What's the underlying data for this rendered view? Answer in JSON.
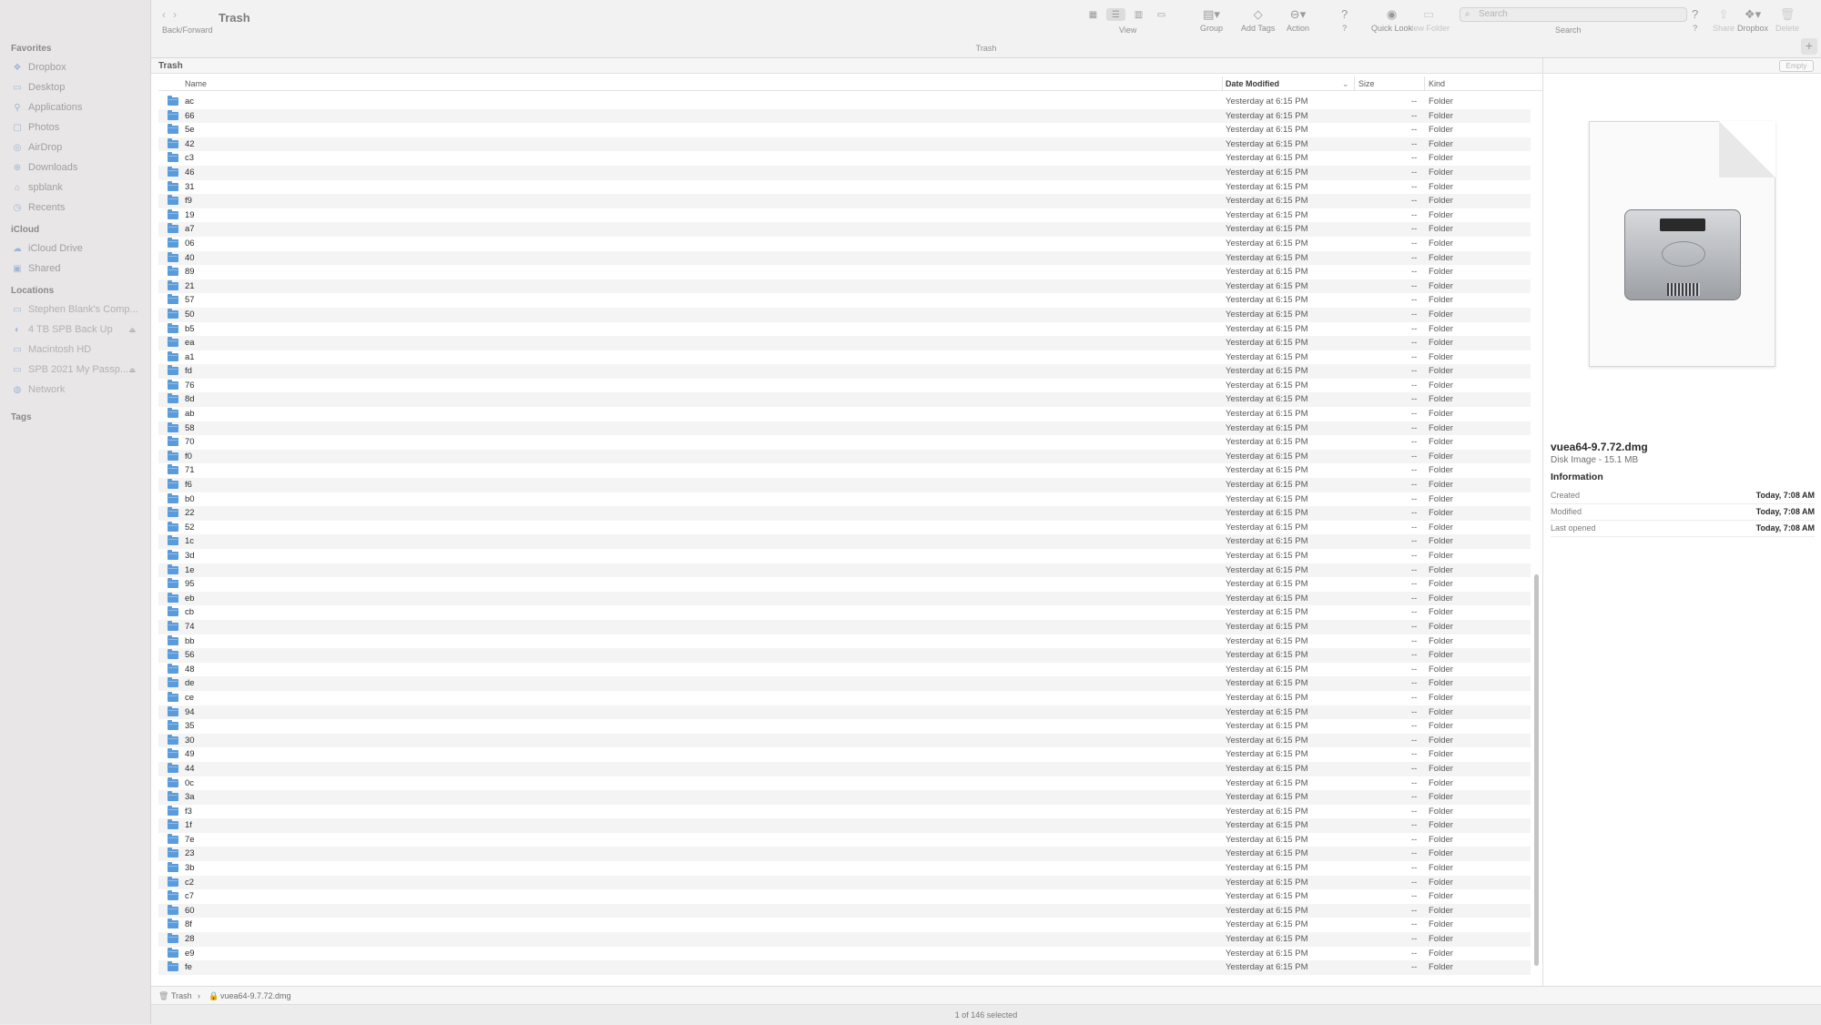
{
  "toolbar": {
    "nav_label": "Back/Forward",
    "title": "Trash",
    "view_label": "View",
    "group_label": "Group",
    "add_tags_label": "Add Tags",
    "action_label": "Action",
    "help_label": "?",
    "quick_look_label": "Quick Look",
    "new_folder_label": "New Folder",
    "search_placeholder": "Search",
    "search_label": "Search",
    "help2_label": "?",
    "share_label": "Share",
    "dropbox_label": "Dropbox",
    "delete_label": "Delete",
    "path_title": "Trash"
  },
  "sidebar": {
    "favorites_title": "Favorites",
    "favorites": [
      {
        "label": "Dropbox",
        "icon": "dropbox-icon"
      },
      {
        "label": "Desktop",
        "icon": "desktop-icon"
      },
      {
        "label": "Applications",
        "icon": "applications-icon"
      },
      {
        "label": "Photos",
        "icon": "photos-icon"
      },
      {
        "label": "AirDrop",
        "icon": "airdrop-icon"
      },
      {
        "label": "Downloads",
        "icon": "downloads-icon"
      },
      {
        "label": "spblank",
        "icon": "home-icon"
      },
      {
        "label": "Recents",
        "icon": "recents-icon"
      }
    ],
    "icloud_title": "iCloud",
    "icloud": [
      {
        "label": "iCloud Drive",
        "icon": "icloud-icon"
      },
      {
        "label": "Shared",
        "icon": "shared-folder-icon"
      }
    ],
    "locations_title": "Locations",
    "locations": [
      {
        "label": "Stephen Blank's Comp...",
        "icon": "computer-icon"
      },
      {
        "label": "4 TB SPB Back Up",
        "icon": "timemachine-icon",
        "eject": true
      },
      {
        "label": "Macintosh HD",
        "icon": "disk-icon"
      },
      {
        "label": "SPB 2021 My Passp...",
        "icon": "disk-icon",
        "eject": true
      },
      {
        "label": "Network",
        "icon": "network-icon"
      }
    ],
    "tags_title": "Tags"
  },
  "content": {
    "header": "Trash",
    "empty_button": "Empty",
    "columns": {
      "name": "Name",
      "date": "Date Modified",
      "size": "Size",
      "kind": "Kind"
    },
    "date_value": "Yesterday at 6:15 PM",
    "size_value": "--",
    "kind_value": "Folder",
    "rows": [
      "ac",
      "66",
      "5e",
      "42",
      "c3",
      "46",
      "31",
      "f9",
      "19",
      "a7",
      "06",
      "40",
      "89",
      "21",
      "57",
      "50",
      "b5",
      "ea",
      "a1",
      "fd",
      "76",
      "8d",
      "ab",
      "58",
      "70",
      "f0",
      "71",
      "f6",
      "b0",
      "22",
      "52",
      "1c",
      "3d",
      "1e",
      "95",
      "eb",
      "cb",
      "74",
      "bb",
      "56",
      "48",
      "de",
      "ce",
      "94",
      "35",
      "30",
      "49",
      "44",
      "0c",
      "3a",
      "f3",
      "1f",
      "7e",
      "23",
      "3b",
      "c2",
      "c7",
      "60",
      "8f",
      "28",
      "e9",
      "fe"
    ]
  },
  "preview": {
    "file_name": "vuea64-9.7.72.dmg",
    "subtitle": "Disk Image - 15.1 MB",
    "info_title": "Information",
    "info": [
      {
        "key": "Created",
        "value": "Today, 7:08 AM"
      },
      {
        "key": "Modified",
        "value": "Today, 7:08 AM"
      },
      {
        "key": "Last opened",
        "value": "Today, 7:08 AM"
      }
    ]
  },
  "pathbar": {
    "root": "Trash",
    "separator": "›",
    "file": "vuea64-9.7.72.dmg"
  },
  "status": "1 of 146 selected"
}
